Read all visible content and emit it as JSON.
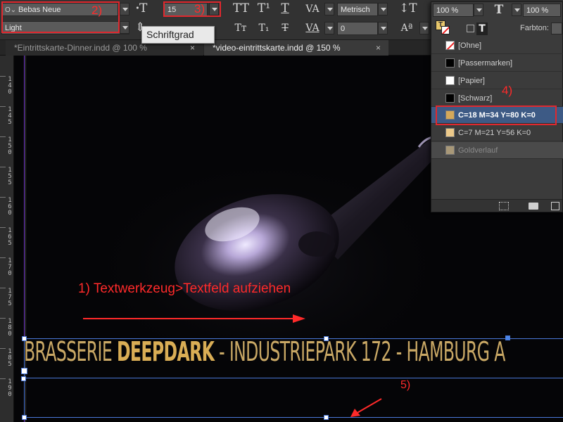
{
  "control_bar": {
    "font_family": "Bebas Neue",
    "font_style": "Light",
    "font_size": "15",
    "kerning": "Metrisch",
    "tracking": "0",
    "vertical_scale": "100 %",
    "horizontal_scale": "100 %",
    "tooltip": "Schriftgrad",
    "farbton_label": "Farbton:"
  },
  "annotations": {
    "step1": "1) Textwerkzeug>Textfeld aufziehen",
    "step2": "2)",
    "step3": "3)",
    "step4": "4)",
    "step5": "5)"
  },
  "tabs": [
    {
      "label": "*Eintrittskarte-Dinner.indd @ 100 %",
      "close": "×",
      "active": false
    },
    {
      "label": "*video-eintrittskarte.indd @ 150 %",
      "close": "×",
      "active": true
    }
  ],
  "ruler": {
    "marks": [
      "1\n4\n0",
      "1\n4\n5",
      "1\n5\n0",
      "1\n5\n5",
      "1\n6\n0",
      "1\n6\n5",
      "1\n7\n0",
      "1\n7\n5",
      "1\n8\n0",
      "1\n8\n5",
      "1\n9\n0"
    ]
  },
  "document": {
    "headline_part1": "BRASSERIE ",
    "headline_bold": "DEEPDARK",
    "headline_part2": " - INDUSTRIEPARK 172 - HAMBURG A"
  },
  "swatches": [
    {
      "label": "[Ohne]",
      "color": "none"
    },
    {
      "label": "[Passermarken]",
      "color": "#000000"
    },
    {
      "label": "[Papier]",
      "color": "#ffffff"
    },
    {
      "label": "[Schwarz]",
      "color": "#000000"
    },
    {
      "label": "C=18 M=34 Y=80 K=0",
      "color": "#d4a85a",
      "selected": true
    },
    {
      "label": "C=7 M=21 Y=56 K=0",
      "color": "#ecc98a"
    },
    {
      "label": "Goldverlauf",
      "color": "#a89878",
      "dim": true
    }
  ],
  "colors": {
    "accent_red": "#e0282e",
    "gold": "#d4a85a",
    "frame_blue": "#4a78d8",
    "selection": "#3d5a85"
  }
}
